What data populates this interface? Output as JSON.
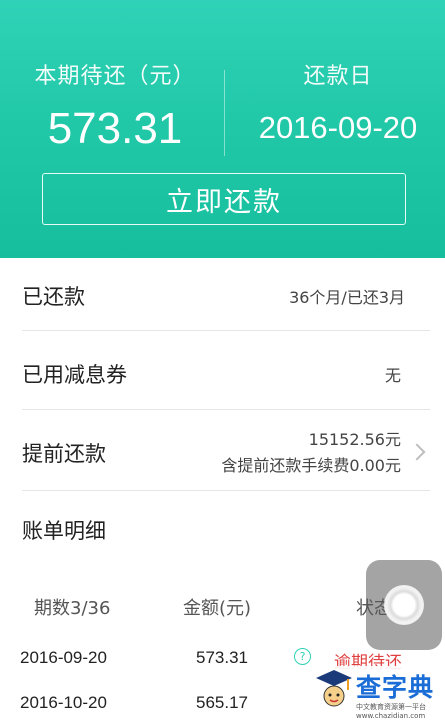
{
  "header": {
    "current_due_label": "本期待还（元）",
    "current_due_amount": "573.31",
    "due_date_label": "还款日",
    "due_date": "2016-09-20",
    "repay_button": "立即还款"
  },
  "rows": {
    "repaid_label": "已还款",
    "repaid_value": "36个月/已还3月",
    "coupon_label": "已用减息券",
    "coupon_value": "无",
    "early_label": "提前还款",
    "early_amount": "15152.56元",
    "early_fee": "含提前还款手续费0.00元",
    "bill_detail_label": "账单明细"
  },
  "table": {
    "headers": [
      "期数3/36",
      "金额(元)",
      "状态"
    ],
    "rows": [
      {
        "date": "2016-09-20",
        "amount": "573.31",
        "status": "逾期待还"
      },
      {
        "date": "2016-10-20",
        "amount": "565.17",
        "status": ""
      }
    ]
  },
  "watermark": {
    "text": "查字典",
    "sub": "中文教育资源第一平台 www.chazidian.com"
  },
  "colors": {
    "accent": "#1fc7a6",
    "overdue": "#e04040"
  },
  "icons": [
    "help-icon",
    "chevron-right-icon",
    "assistive-touch-icon",
    "logo-icon"
  ]
}
